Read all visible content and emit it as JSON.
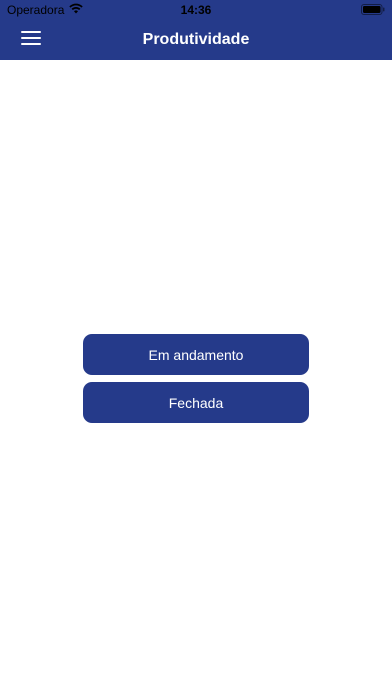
{
  "status_bar": {
    "carrier": "Operadora",
    "time": "14:36",
    "wifi_icon": "wifi-icon",
    "battery_icon": "battery-icon"
  },
  "nav_bar": {
    "title": "Produtividade",
    "menu_icon": "hamburger-menu-icon"
  },
  "main": {
    "buttons": [
      {
        "label": "Em andamento"
      },
      {
        "label": "Fechada"
      }
    ]
  },
  "colors": {
    "primary": "#253a8a",
    "background": "#ffffff",
    "text_on_primary": "#ffffff"
  }
}
